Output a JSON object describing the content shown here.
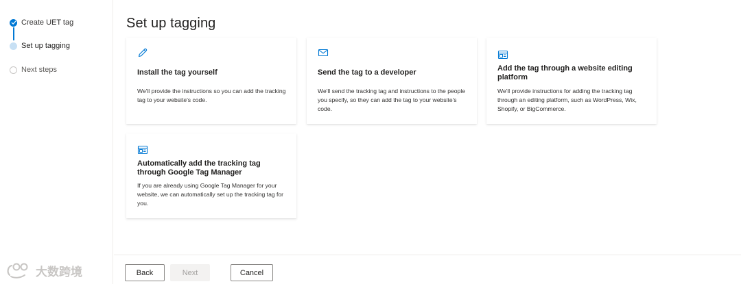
{
  "stepper": {
    "steps": [
      {
        "label": "Create UET tag",
        "state": "done"
      },
      {
        "label": "Set up tagging",
        "state": "current"
      },
      {
        "label": "Next steps",
        "state": "todo"
      }
    ]
  },
  "watermark": {
    "text": "大数跨境"
  },
  "main": {
    "title": "Set up tagging",
    "cards": [
      {
        "icon": "pencil-icon",
        "title": "Install the tag yourself",
        "description": "We'll provide the instructions so you can add the tracking tag to your website's code."
      },
      {
        "icon": "mail-icon",
        "title": "Send the tag to a developer",
        "description": "We'll send the tracking tag and instructions to the people you specify, so they can add the tag to your website's code."
      },
      {
        "icon": "browser-window-icon",
        "title": "Add the tag through a website editing platform",
        "description": "We'll provide instructions for adding the tracking tag through an editing platform, such as WordPress, Wix, Shopify, or BigCommerce."
      },
      {
        "icon": "browser-window-icon",
        "title": "Automatically add the tracking tag through Google Tag Manager",
        "description": "If you are already using Google Tag Manager for your website, we can automatically set up the tracking tag for you."
      }
    ]
  },
  "footer": {
    "back_label": "Back",
    "next_label": "Next",
    "cancel_label": "Cancel"
  },
  "colors": {
    "accent": "#0078d4",
    "current_step": "#c7e0f4",
    "border": "#edebe9"
  }
}
